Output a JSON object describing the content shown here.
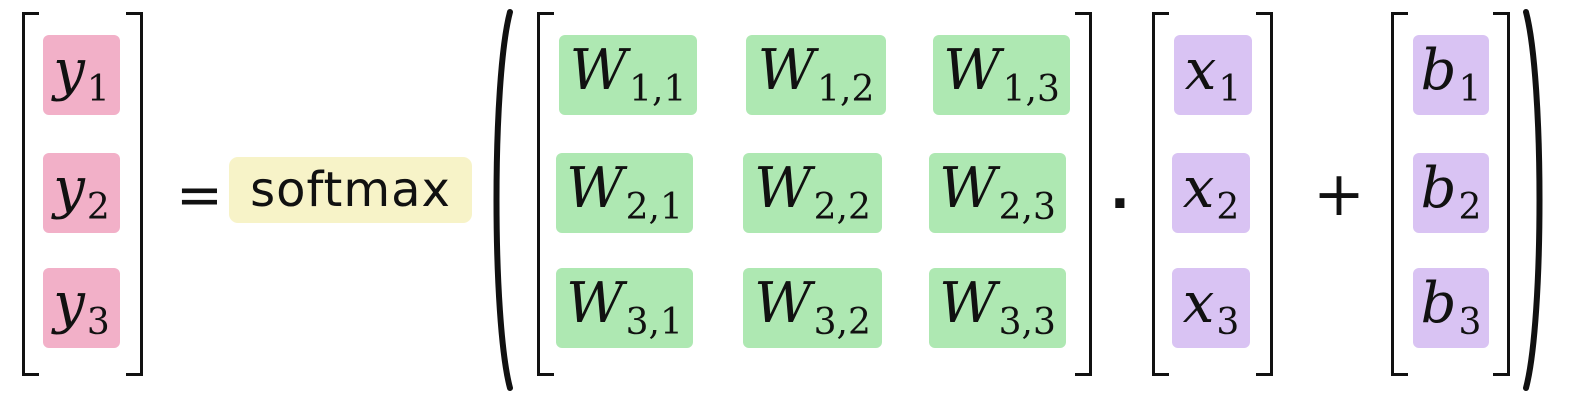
{
  "equation": {
    "output": [
      {
        "var": "y",
        "sub": "1"
      },
      {
        "var": "y",
        "sub": "2"
      },
      {
        "var": "y",
        "sub": "3"
      }
    ],
    "equals": "=",
    "function_name": "softmax",
    "weights": [
      [
        {
          "var": "W",
          "sub": "1,1"
        },
        {
          "var": "W",
          "sub": "1,2"
        },
        {
          "var": "W",
          "sub": "1,3"
        }
      ],
      [
        {
          "var": "W",
          "sub": "2,1"
        },
        {
          "var": "W",
          "sub": "2,2"
        },
        {
          "var": "W",
          "sub": "2,3"
        }
      ],
      [
        {
          "var": "W",
          "sub": "3,1"
        },
        {
          "var": "W",
          "sub": "3,2"
        },
        {
          "var": "W",
          "sub": "3,3"
        }
      ]
    ],
    "dot": "·",
    "input": [
      {
        "var": "x",
        "sub": "1"
      },
      {
        "var": "x",
        "sub": "2"
      },
      {
        "var": "x",
        "sub": "3"
      }
    ],
    "plus": "+",
    "bias": [
      {
        "var": "b",
        "sub": "1"
      },
      {
        "var": "b",
        "sub": "2"
      },
      {
        "var": "b",
        "sub": "3"
      }
    ]
  },
  "colors": {
    "output": "#f2b0c8",
    "function": "#f7f3c8",
    "weights": "#aee8b2",
    "input": "#d9c3f3",
    "bias": "#d9c3f3"
  }
}
